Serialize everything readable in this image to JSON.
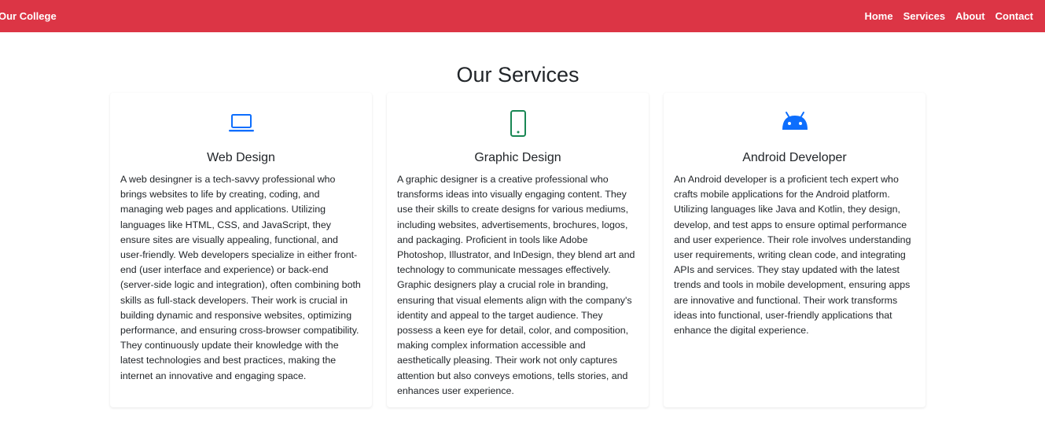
{
  "navbar": {
    "brand": "Our College",
    "color": "#dc3545",
    "links": [
      "Home",
      "Services",
      "About",
      "Contact"
    ]
  },
  "main": {
    "title": "Our Services"
  },
  "cards": [
    {
      "icon": "laptop-icon",
      "icon_color": "#0d6efd",
      "title": "Web Design",
      "text": "A web desingner is a tech-savvy professional who brings websites to life by creating, coding, and managing web pages and applications. Utilizing languages like HTML, CSS, and JavaScript, they ensure sites are visually appealing, functional, and user-friendly. Web developers specialize in either front-end (user interface and experience) or back-end (server-side logic and integration), often combining both skills as full-stack developers. Their work is crucial in building dynamic and responsive websites, optimizing performance, and ensuring cross-browser compatibility. They continuously update their knowledge with the latest technologies and best practices, making the internet an innovative and engaging space."
    },
    {
      "icon": "phone-icon",
      "icon_color": "#198754",
      "title": "Graphic Design",
      "text": "A graphic designer is a creative professional who transforms ideas into visually engaging content. They use their skills to create designs for various mediums, including websites, advertisements, brochures, logos, and packaging. Proficient in tools like Adobe Photoshop, Illustrator, and InDesign, they blend art and technology to communicate messages effectively. Graphic designers play a crucial role in branding, ensuring that visual elements align with the company's identity and appeal to the target audience. They possess a keen eye for detail, color, and composition, making complex information accessible and aesthetically pleasing. Their work not only captures attention but also conveys emotions, tells stories, and enhances user experience."
    },
    {
      "icon": "android-icon",
      "icon_color": "#0d6efd",
      "title": "Android Developer",
      "text": "An Android developer is a proficient tech expert who crafts mobile applications for the Android platform. Utilizing languages like Java and Kotlin, they design, develop, and test apps to ensure optimal performance and user experience. Their role involves understanding user requirements, writing clean code, and integrating APIs and services. They stay updated with the latest trends and tools in mobile development, ensuring apps are innovative and functional. Their work transforms ideas into functional, user-friendly applications that enhance the digital experience."
    }
  ]
}
